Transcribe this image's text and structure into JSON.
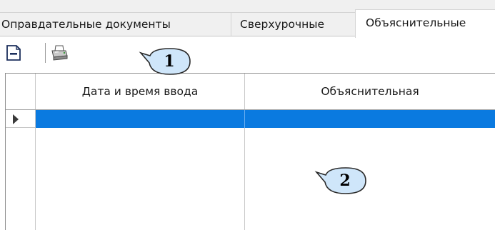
{
  "tabs": [
    {
      "label": "Оправдательные документы",
      "active": false
    },
    {
      "label": "Сверхурочные",
      "active": false
    },
    {
      "label": "Объяснительные",
      "active": true
    }
  ],
  "toolbar": {
    "buttons": [
      {
        "name": "collapse",
        "icon": "minus-box-icon"
      },
      {
        "name": "print",
        "icon": "printer-icon"
      }
    ]
  },
  "grid": {
    "columns": [
      "Дата и время ввода",
      "Объяснительная"
    ],
    "rows": [
      {
        "date_time": "",
        "explanation": "",
        "selected": true
      }
    ]
  },
  "callouts": [
    {
      "label": "1"
    },
    {
      "label": "2"
    }
  ],
  "colors": {
    "selection": "#0a7ae0",
    "tab_background": "#f0f0f0",
    "callout_fill": "#cfe6fa",
    "callout_stroke": "#2a2a2a"
  }
}
